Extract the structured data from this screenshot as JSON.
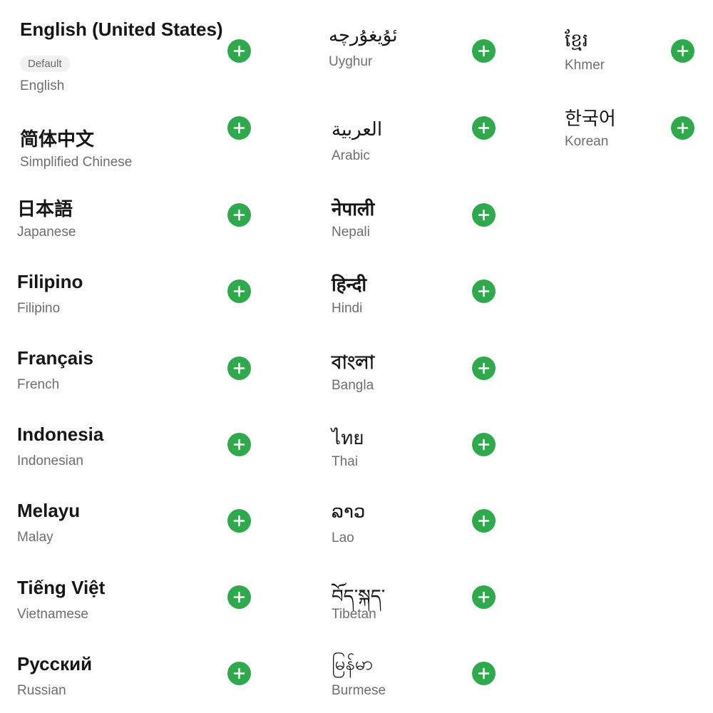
{
  "languages": [
    {
      "native": "English (United States)",
      "english": "English",
      "badge": "Default"
    },
    {
      "native": "简体中文",
      "english": "Simplified Chinese"
    },
    {
      "native": "日本語",
      "english": "Japanese"
    },
    {
      "native": "Filipino",
      "english": "Filipino"
    },
    {
      "native": "Français",
      "english": "French"
    },
    {
      "native": "Indonesia",
      "english": "Indonesian"
    },
    {
      "native": "Melayu",
      "english": "Malay"
    },
    {
      "native": "Tiếng Việt",
      "english": "Vietnamese"
    },
    {
      "native": "Русский",
      "english": "Russian"
    },
    {
      "native": "ئۇيغۇرچە",
      "english": "Uyghur"
    },
    {
      "native": "العربية",
      "english": "Arabic"
    },
    {
      "native": "नेपाली",
      "english": "Nepali"
    },
    {
      "native": "हिन्दी",
      "english": "Hindi"
    },
    {
      "native": "বাংলা",
      "english": "Bangla"
    },
    {
      "native": "ไทย",
      "english": "Thai"
    },
    {
      "native": "ລາວ",
      "english": "Lao"
    },
    {
      "native": "བོད་སྐད་",
      "english": "Tibetan"
    },
    {
      "native": "မြန်မာ",
      "english": "Burmese"
    },
    {
      "native": "ខ្មែរ",
      "english": "Khmer"
    },
    {
      "native": "한국어",
      "english": "Korean"
    }
  ],
  "add_icon": "plus-circle-icon",
  "colors": {
    "accent": "#2eaa4d",
    "title": "#161616",
    "subtitle": "#6e6e6e",
    "badge_bg": "#f1f1f1"
  }
}
